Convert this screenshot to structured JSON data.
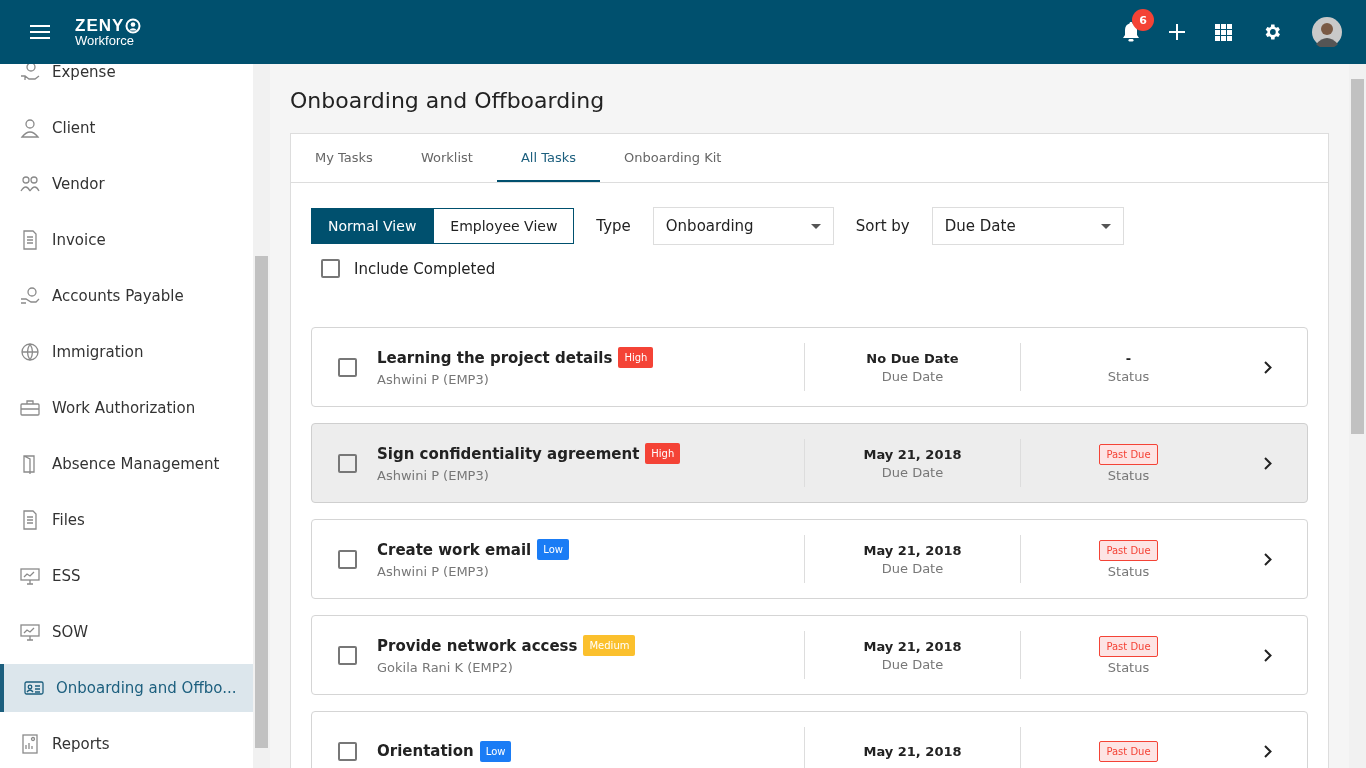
{
  "header": {
    "logo_top": "ZENY",
    "logo_bottom": "Workforce",
    "notification_count": "6"
  },
  "sidebar": {
    "items": [
      {
        "label": "Expense",
        "selected": false
      },
      {
        "label": "Client",
        "selected": false
      },
      {
        "label": "Vendor",
        "selected": false
      },
      {
        "label": "Invoice",
        "selected": false
      },
      {
        "label": "Accounts Payable",
        "selected": false
      },
      {
        "label": "Immigration",
        "selected": false
      },
      {
        "label": "Work Authorization",
        "selected": false
      },
      {
        "label": "Absence Management",
        "selected": false
      },
      {
        "label": "Files",
        "selected": false
      },
      {
        "label": "ESS",
        "selected": false
      },
      {
        "label": "SOW",
        "selected": false
      },
      {
        "label": "Onboarding and Offbo...",
        "selected": true
      },
      {
        "label": "Reports",
        "selected": false
      }
    ]
  },
  "page": {
    "title": "Onboarding and Offboarding"
  },
  "tabs": [
    {
      "label": "My Tasks",
      "selected": false
    },
    {
      "label": "Worklist",
      "selected": false
    },
    {
      "label": "All Tasks",
      "selected": true
    },
    {
      "label": "Onboarding Kit",
      "selected": false
    }
  ],
  "view_toggle": [
    {
      "label": "Normal View",
      "selected": true
    },
    {
      "label": "Employee View",
      "selected": false
    }
  ],
  "filters": {
    "type_label": "Type",
    "type_value": "Onboarding",
    "sort_label": "Sort by",
    "sort_value": "Due Date"
  },
  "include_completed": {
    "label": "Include Completed",
    "checked": false
  },
  "tasks": [
    {
      "title": "Learning the project details",
      "priority": "High",
      "color": "#f44336",
      "assignee": "Ashwini P (EMP3)",
      "due": "No Due Date",
      "due_label": "Due Date",
      "status": {
        "kind": "plain",
        "text": "-"
      },
      "status_label": "Status",
      "checked": false,
      "highlighted": false
    },
    {
      "title": "Sign confidentiality agreement",
      "priority": "High",
      "color": "#f44336",
      "assignee": "Ashwini P (EMP3)",
      "due": "May 21, 2018",
      "due_label": "Due Date",
      "status": {
        "kind": "badge",
        "text": "Past Due"
      },
      "status_label": "Status",
      "checked": false,
      "highlighted": true
    },
    {
      "title": "Create work email",
      "priority": "Low",
      "color": "#1a7cf5",
      "assignee": "Ashwini P (EMP3)",
      "due": "May 21, 2018",
      "due_label": "Due Date",
      "status": {
        "kind": "badge",
        "text": "Past Due"
      },
      "status_label": "Status",
      "checked": false,
      "highlighted": false
    },
    {
      "title": "Provide network access",
      "priority": "Medium",
      "color": "#fbc02d",
      "assignee": "Gokila Rani K (EMP2)",
      "due": "May 21, 2018",
      "due_label": "Due Date",
      "status": {
        "kind": "badge",
        "text": "Past Due"
      },
      "status_label": "Status",
      "checked": false,
      "highlighted": false
    },
    {
      "title": "Orientation",
      "priority": "Low",
      "color": "#1a7cf5",
      "due": "May 21, 2018",
      "status": {
        "kind": "badge",
        "text": "Past Due"
      },
      "checked": false,
      "highlighted": false
    }
  ]
}
